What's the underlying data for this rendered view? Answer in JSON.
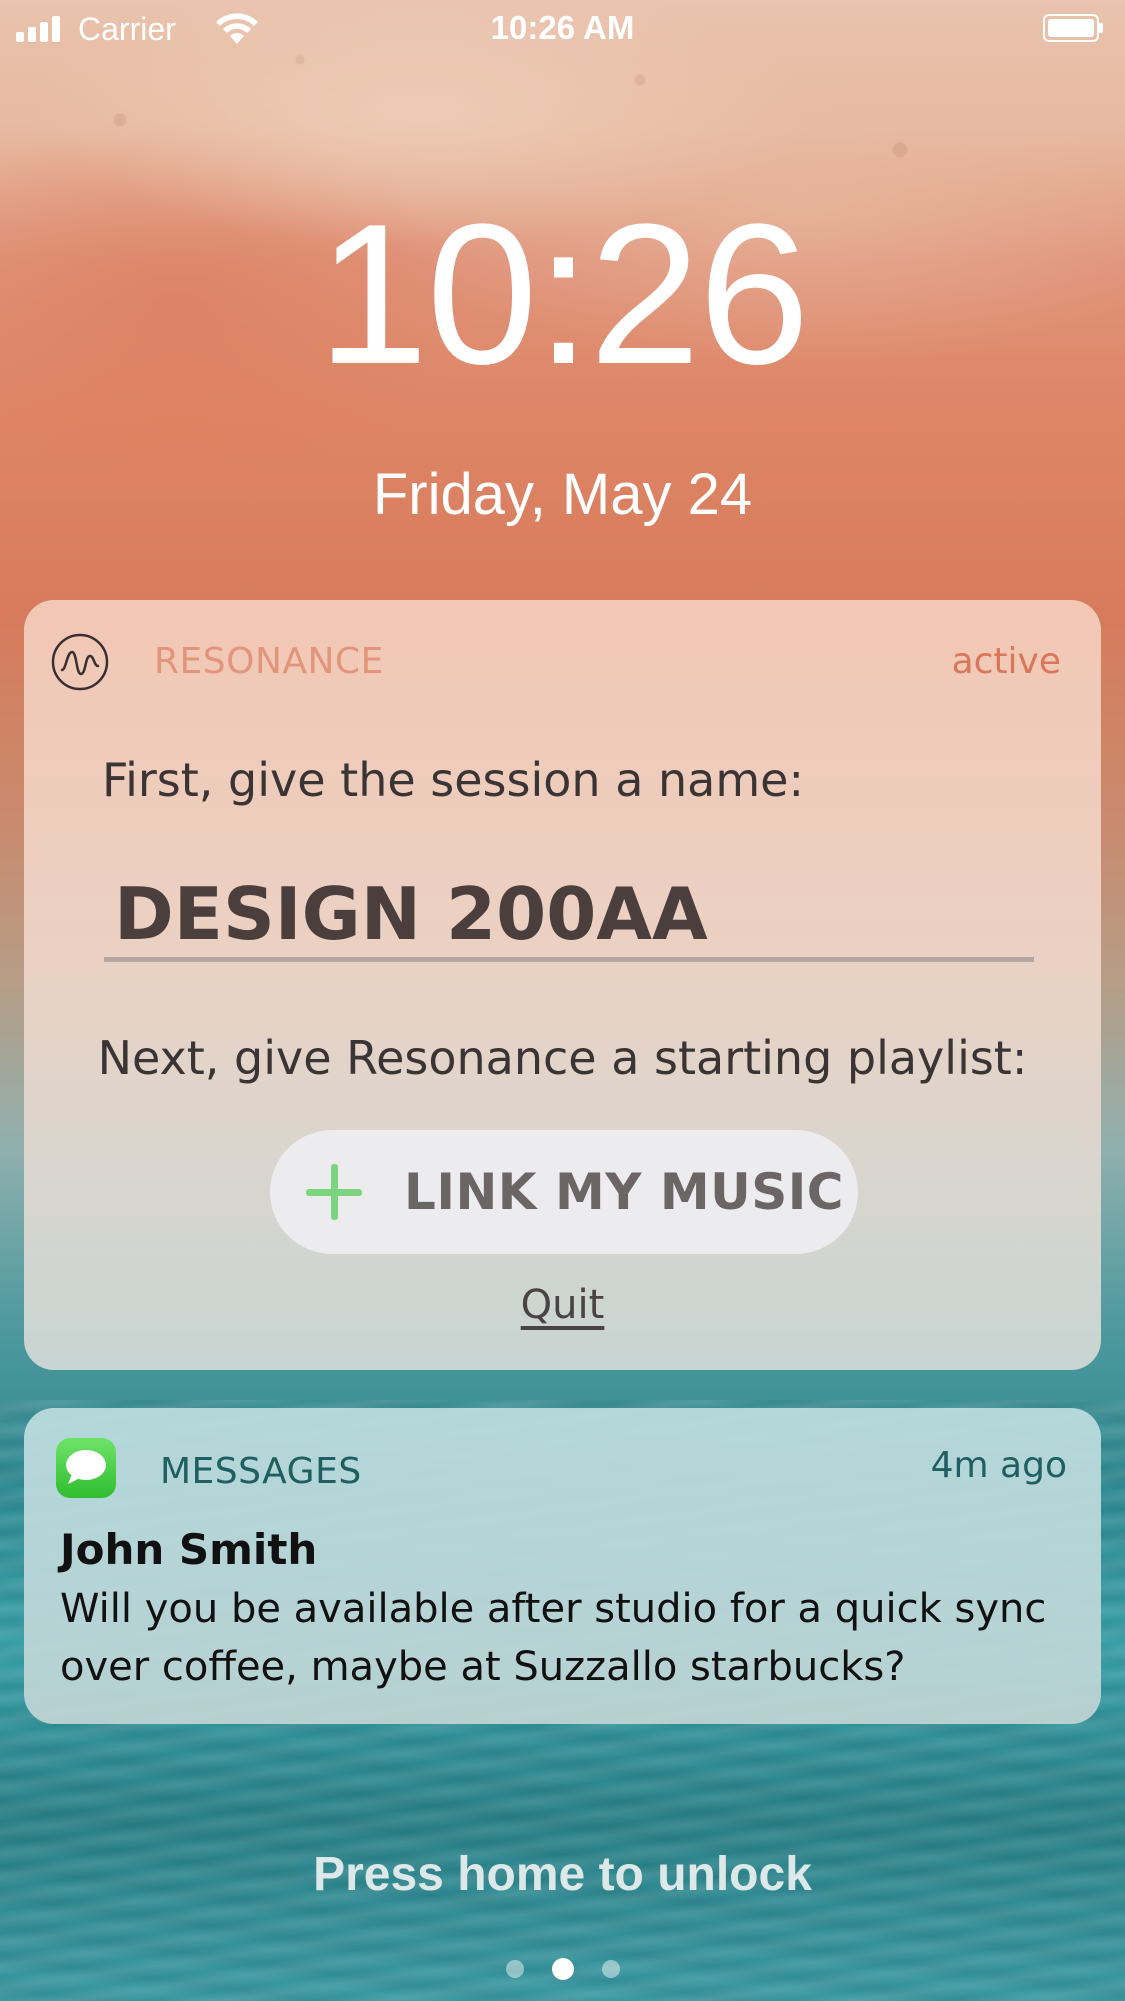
{
  "status_bar": {
    "carrier": "Carrier",
    "time": "10:26 AM"
  },
  "lock_screen": {
    "clock": "10:26",
    "date": "Friday, May 24",
    "unlock_hint": "Press home to unlock",
    "page_count": 3,
    "active_page": 2
  },
  "resonance_notification": {
    "app_name": "RESONANCE",
    "status": "active",
    "prompt_name": "First, give the session a name:",
    "session_name_value": "DESIGN 200AA",
    "prompt_playlist": "Next, give Resonance a starting playlist:",
    "link_button_label": "LINK MY MUSIC",
    "quit_label": "Quit",
    "colors": {
      "app_name": "#e2957a",
      "status": "#d8775a",
      "plus_icon": "#7bd47e"
    }
  },
  "messages_notification": {
    "app_name": "MESSAGES",
    "time_ago": "4m ago",
    "sender": "John Smith",
    "body": "Will you be available after studio for a quick sync over coffee, maybe at Suzzallo starbucks?",
    "colors": {
      "app_icon": "#2fbd2f"
    }
  },
  "icons": {
    "signal": "signal-strength-icon",
    "wifi": "wifi-icon",
    "battery": "battery-icon",
    "resonance_logo": "resonance-logo-icon",
    "messages_app": "messages-app-icon",
    "plus": "plus-icon"
  }
}
